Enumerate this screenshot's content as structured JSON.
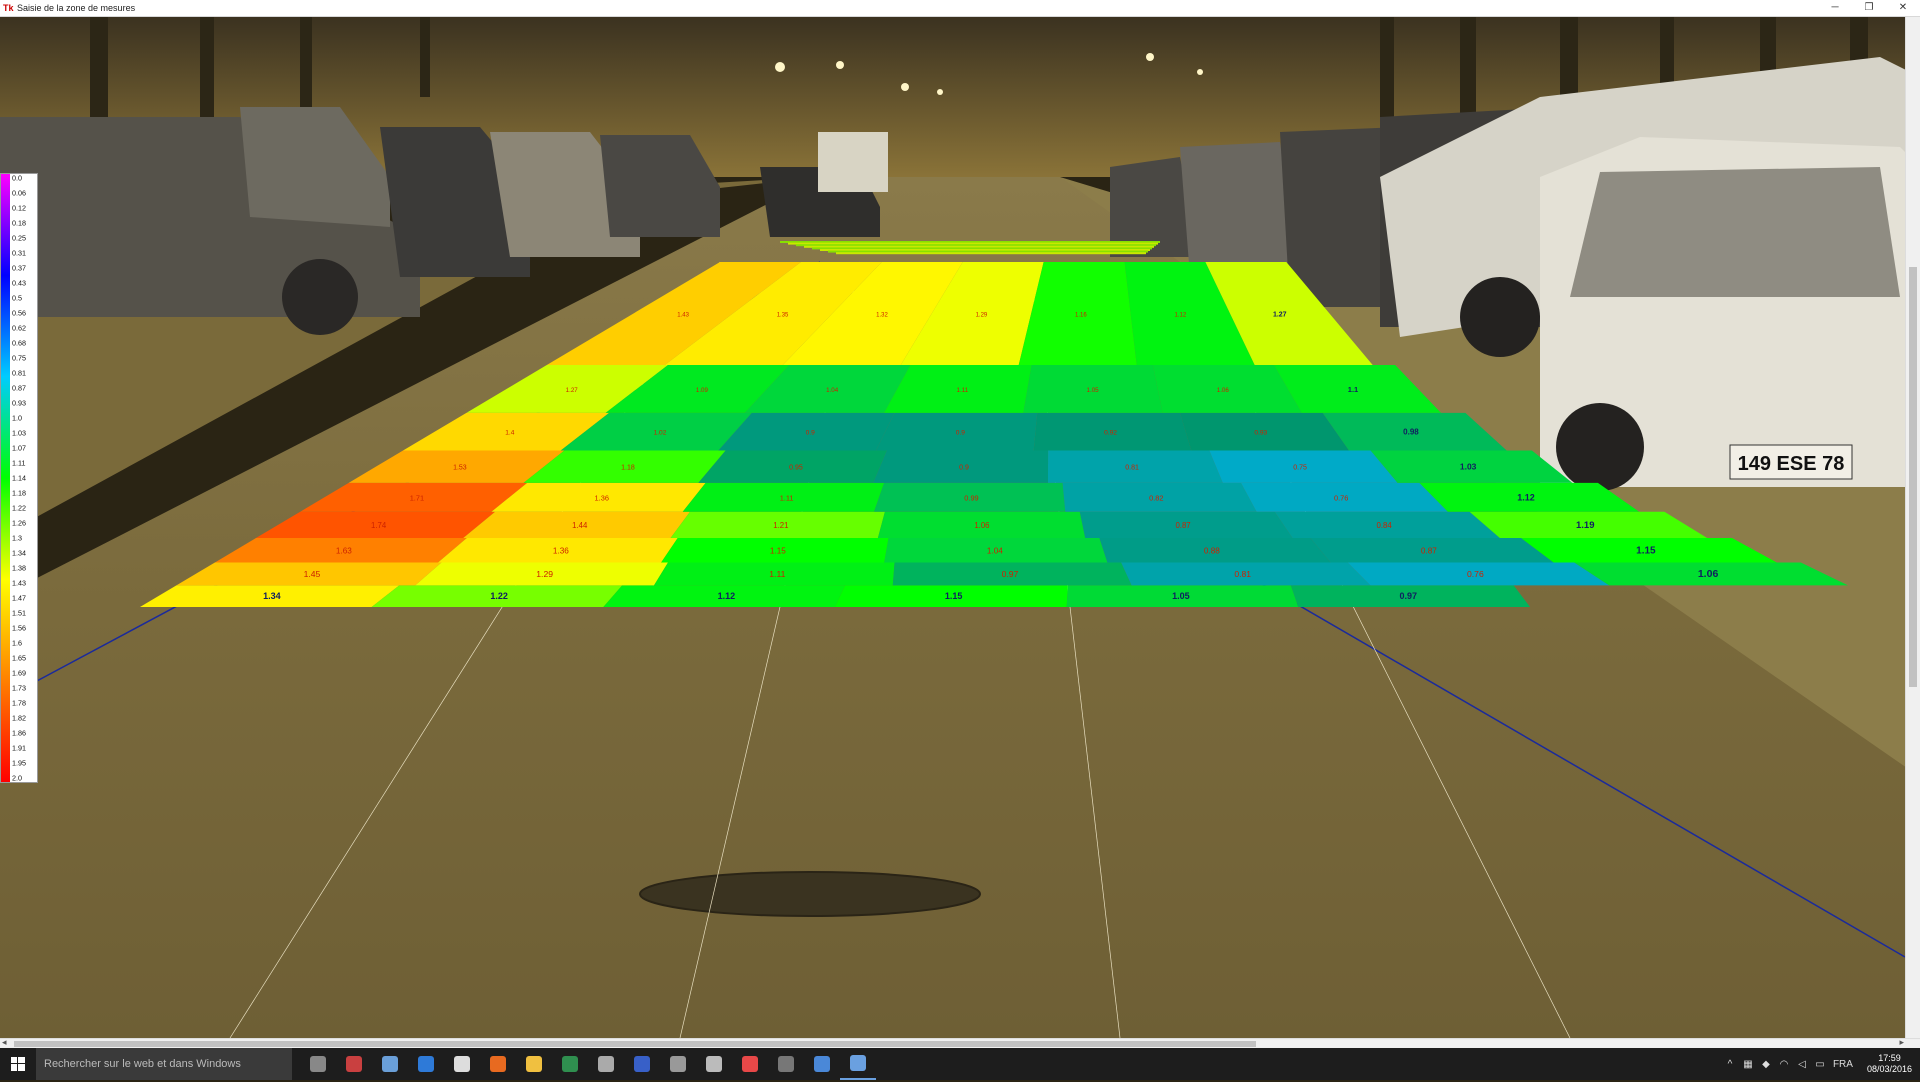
{
  "window": {
    "title": "Saisie de la zone de mesures",
    "app_icon": "Tk",
    "controls": [
      "─",
      "❐",
      "✕"
    ]
  },
  "legend": {
    "labels": [
      "0.0",
      "0.06",
      "0.12",
      "0.18",
      "0.25",
      "0.31",
      "0.37",
      "0.43",
      "0.5",
      "0.56",
      "0.62",
      "0.68",
      "0.75",
      "0.81",
      "0.87",
      "0.93",
      "1.0",
      "1.03",
      "1.07",
      "1.11",
      "1.14",
      "1.18",
      "1.22",
      "1.26",
      "1.3",
      "1.34",
      "1.38",
      "1.43",
      "1.47",
      "1.51",
      "1.56",
      "1.6",
      "1.65",
      "1.69",
      "1.73",
      "1.78",
      "1.82",
      "1.86",
      "1.91",
      "1.95",
      "2.0"
    ],
    "colors": [
      "#ff00ff",
      "#0000ff",
      "#00ccff",
      "#00ff00",
      "#ffff00",
      "#ff8000",
      "#ff0000"
    ]
  },
  "plate": {
    "text": "149 ESE 78"
  },
  "grid": {
    "rows": [
      {
        "values": [
          "1.43",
          "1.35",
          "1.32",
          "1.29",
          "1.16",
          "1.12",
          "1.27"
        ],
        "label_color": "#cc2200"
      },
      {
        "values": [
          "1.27",
          "1.09",
          "1.04",
          "1.11",
          "1.05",
          "1.06",
          "1.1"
        ],
        "label_color": "#cc2200"
      },
      {
        "values": [
          "1.4",
          "1.02",
          "0.9",
          "0.9",
          "0.92",
          "0.93",
          "0.98"
        ],
        "label_color": "#cc2200"
      },
      {
        "values": [
          "1.53",
          "1.18",
          "0.95",
          "0.9",
          "0.81",
          "0.75",
          "1.03"
        ],
        "label_color": "#cc2200"
      },
      {
        "values": [
          "1.71",
          "1.36",
          "1.11",
          "0.99",
          "0.82",
          "0.76",
          "1.12"
        ],
        "label_color": "#cc2200"
      },
      {
        "values": [
          "1.74",
          "1.44",
          "1.21",
          "1.06",
          "0.87",
          "0.84",
          "1.19"
        ],
        "label_color": "#cc2200"
      },
      {
        "values": [
          "1.63",
          "1.36",
          "1.15",
          "1.04",
          "0.88",
          "0.87",
          "1.15"
        ],
        "label_color": "#cc2200"
      },
      {
        "values": [
          "1.45",
          "1.29",
          "1.11",
          "0.97",
          "0.81",
          "0.76",
          "1.06"
        ],
        "label_color": "#cc2200"
      },
      {
        "values": [
          "1.34",
          "1.22",
          "1.12",
          "1.15",
          "1.05",
          "0.97"
        ],
        "label_color": "#102060"
      }
    ]
  },
  "scrollbar": {
    "h_left": "◂",
    "h_right": "▸"
  },
  "taskbar": {
    "search_placeholder": "Rechercher sur le web et dans Windows",
    "apps": [
      "task-view",
      "pdf-app",
      "tool-app",
      "edge",
      "store",
      "firefox",
      "explorer",
      "excel",
      "inkscape",
      "visio",
      "printer",
      "safari",
      "paint",
      "terminal",
      "chrome",
      "images"
    ],
    "tray_lang": "FRA",
    "time": "17:59",
    "date": "08/03/2016"
  }
}
